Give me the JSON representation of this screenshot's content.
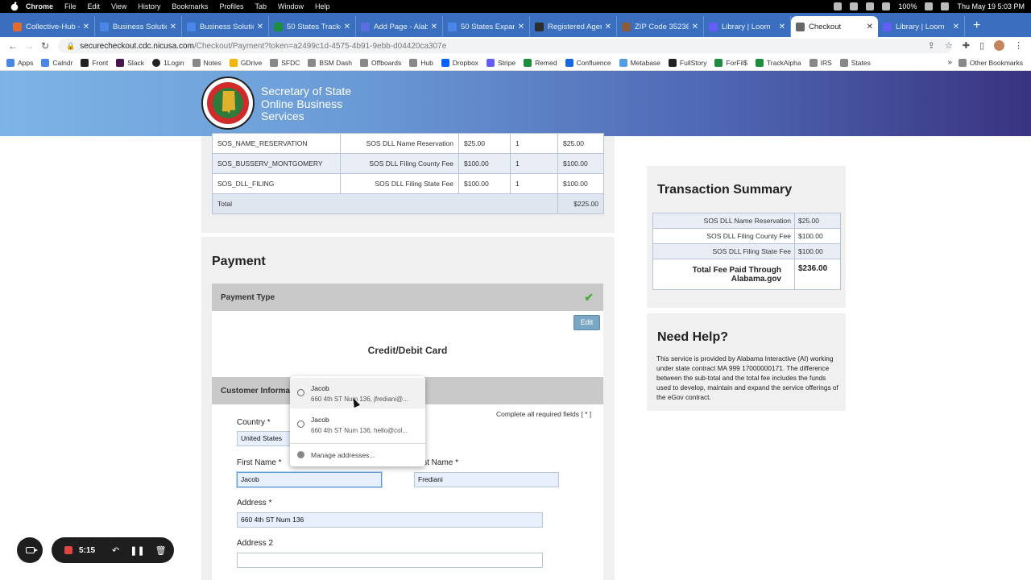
{
  "menubar": {
    "app": "Chrome",
    "items": [
      "File",
      "Edit",
      "View",
      "History",
      "Bookmarks",
      "Profiles",
      "Tab",
      "Window",
      "Help"
    ],
    "battery": "100%",
    "clock": "Thu May 19  5:03 PM"
  },
  "tabs": [
    {
      "title": "Collective-Hub -",
      "color": "#e36b2c"
    },
    {
      "title": "Business Solutio",
      "color": "#4a86e8"
    },
    {
      "title": "Business Solutio",
      "color": "#4a86e8"
    },
    {
      "title": "50 States Tracke",
      "color": "#1e8e3e"
    },
    {
      "title": "Add Page - Alab",
      "color": "#5b6ee1"
    },
    {
      "title": "50 States Expanc",
      "color": "#4a86e8"
    },
    {
      "title": "Registered Agen",
      "color": "#2d2d2d"
    },
    {
      "title": "ZIP Code 35236",
      "color": "#8e5a3c"
    },
    {
      "title": "Library | Loom",
      "color": "#625df5"
    },
    {
      "title": "Checkout",
      "color": "#666666",
      "active": true
    },
    {
      "title": "Library | Loom",
      "color": "#625df5"
    }
  ],
  "address": {
    "host": "securecheckout.cdc.nicusa.com",
    "path": "/Checkout/Payment?token=a2499c1d-4575-4b91-9ebb-d04420ca307e"
  },
  "bookmarks": [
    "Apps",
    "Calndr",
    "Front",
    "Slack",
    "1Login",
    "Notes",
    "GDrive",
    "SFDC",
    "BSM Dash",
    "Offboards",
    "Hub",
    "Dropbox",
    "Stripe",
    "Remed",
    "Confluence",
    "Metabase",
    "FullStory",
    "ForFil$",
    "TrackAlpha",
    "IRS",
    "States"
  ],
  "bookmarks_more": "»",
  "bookmarks_other": "Other Bookmarks",
  "header": {
    "seal_text": "ALABAMA GREAT SEAL",
    "title_line1": "Secretary of State",
    "title_line2": "Online Business",
    "title_line3": "Services"
  },
  "fees_table": {
    "rows": [
      {
        "code": "SOS_NAME_RESERVATION",
        "desc": "SOS DLL Name Reservation",
        "price": "$25.00",
        "qty": "1",
        "total": "$25.00"
      },
      {
        "code": "SOS_BUSSERV_MONTGOMERY",
        "desc": "SOS DLL Filing County Fee",
        "price": "$100.00",
        "qty": "1",
        "total": "$100.00"
      },
      {
        "code": "SOS_DLL_FILING",
        "desc": "SOS DLL Filing State Fee",
        "price": "$100.00",
        "qty": "1",
        "total": "$100.00"
      }
    ],
    "total_label": "Total",
    "total_value": "$225.00"
  },
  "payment": {
    "heading": "Payment",
    "type_label": "Payment Type",
    "edit_label": "Edit",
    "card_type": "Credit/Debit Card",
    "customer_info_label": "Customer Information",
    "required_note": "Complete all required fields [ * ]"
  },
  "form": {
    "country_label": "Country *",
    "country_value": "United States",
    "first_name_label": "First Name *",
    "first_name_value": "Jacob",
    "last_name_label": "Last Name *",
    "last_name_value": "Frediani",
    "address_label": "Address *",
    "address_value": "660 4th ST Num 136",
    "address2_label": "Address 2",
    "address2_value": ""
  },
  "autofill": {
    "items": [
      {
        "name": "Jacob",
        "detail": "660 4th ST Num 136, jfrediani@..."
      },
      {
        "name": "Jacob",
        "detail": "660 4th ST Num 136, hello@col..."
      }
    ],
    "manage": "Manage addresses..."
  },
  "summary": {
    "heading": "Transaction Summary",
    "rows": [
      {
        "label": "SOS DLL Name Reservation",
        "value": "$25.00"
      },
      {
        "label": "SOS DLL Filing County Fee",
        "value": "$100.00"
      },
      {
        "label": "SOS DLL Filing State Fee",
        "value": "$100.00"
      }
    ],
    "total_label": "Total Fee Paid Through Alabama.gov",
    "total_value": "$236.00"
  },
  "help": {
    "heading": "Need Help?",
    "text": "This service is provided by Alabama Interactive (AI) working under state contract MA 999 17000000171. The difference between the sub-total and the total fee includes the funds used to develop, maintain and expand the service offerings of the eGov contract."
  },
  "loom": {
    "time": "5:15"
  }
}
